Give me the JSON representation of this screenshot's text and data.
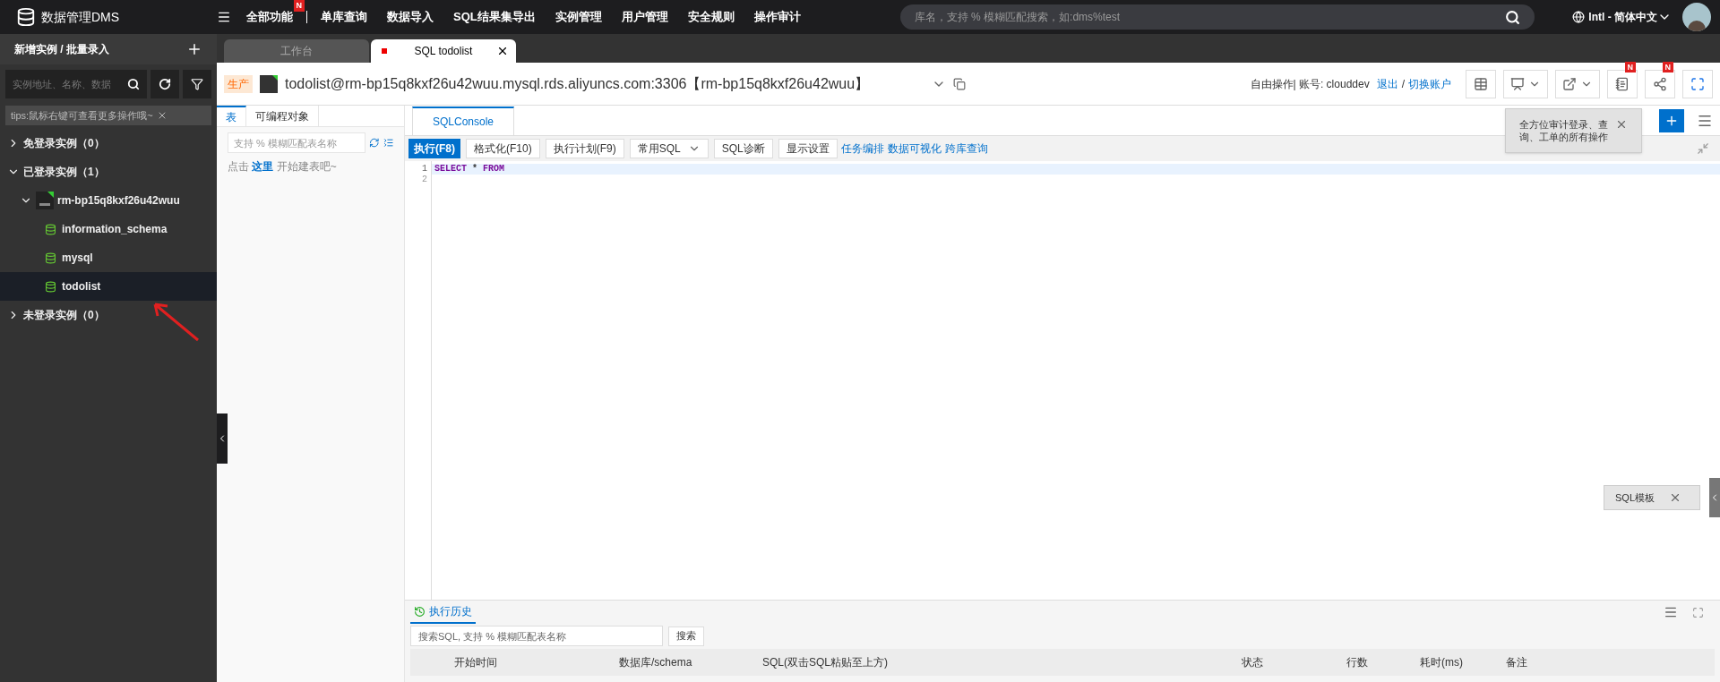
{
  "app": {
    "title": "数据管理DMS"
  },
  "top_menu": [
    {
      "label": "全部功能",
      "badge": "N"
    },
    {
      "label": "单库查询"
    },
    {
      "label": "数据导入"
    },
    {
      "label": "SQL结果集导出"
    },
    {
      "label": "实例管理"
    },
    {
      "label": "用户管理"
    },
    {
      "label": "安全规则"
    },
    {
      "label": "操作审计"
    }
  ],
  "search": {
    "placeholder": "库名，支持 % 模糊匹配搜索，如:dms%test"
  },
  "language": "Intl - 简体中文",
  "sidebar": {
    "title": "新增实例 / 批量录入",
    "search_placeholder": "实例地址、名称、数据",
    "tip": "tips:鼠标右键可查看更多操作哦~",
    "tree": [
      {
        "label": "免登录实例（0）",
        "kind": "group",
        "expanded": false,
        "selected": false
      },
      {
        "label": "已登录实例（1）",
        "kind": "group",
        "expanded": true,
        "selected": false,
        "children": [
          {
            "label": "rm-bp15q8kxf26u42wuu",
            "kind": "instance",
            "expanded": true,
            "selected": false,
            "children": [
              {
                "label": "information_schema",
                "kind": "database",
                "selected": false
              },
              {
                "label": "mysql",
                "kind": "database",
                "selected": false
              },
              {
                "label": "todolist",
                "kind": "database",
                "selected": true
              }
            ]
          }
        ]
      },
      {
        "label": "未登录实例（0）",
        "kind": "group",
        "expanded": false,
        "selected": false
      }
    ]
  },
  "tabs": [
    {
      "label": "工作台",
      "selected": false
    },
    {
      "label": "SQL todolist",
      "selected": true
    }
  ],
  "header": {
    "env": "生产",
    "connection": "todolist@rm-bp15q8kxf26u42wuu.mysql.rds.aliyuncs.com:3306【rm-bp15q8kxf26u42wuu】",
    "account": "自由操作| 账号: clouddev",
    "logout": "退出",
    "separator": "/",
    "switch": "切换账户",
    "tools": [
      {
        "kind": "table",
        "dropdown": false
      },
      {
        "kind": "chart",
        "dropdown": true
      },
      {
        "kind": "export",
        "dropdown": true
      },
      {
        "kind": "audit",
        "dropdown": false,
        "badge": "N"
      },
      {
        "kind": "share",
        "dropdown": false,
        "badge": "N"
      },
      {
        "kind": "fullscreen",
        "dropdown": false
      }
    ]
  },
  "object_panel": {
    "tabs": [
      {
        "label": "表",
        "selected": true
      },
      {
        "label": "可编程对象",
        "selected": false
      }
    ],
    "search_placeholder": "支持 % 模糊匹配表名称",
    "hint": {
      "before": "点击",
      "link": "这里",
      "after": "开始建表吧~"
    }
  },
  "editor": {
    "tabs": [
      {
        "label": "SQLConsole",
        "selected": true
      }
    ],
    "toolbar": [
      {
        "label": "执行(F8)",
        "kind": "primary"
      },
      {
        "label": "格式化(F10)",
        "kind": "button"
      },
      {
        "label": "执行计划(F9)",
        "kind": "button"
      },
      {
        "label": "常用SQL",
        "kind": "dropdown"
      },
      {
        "label": "SQL诊断",
        "kind": "button"
      },
      {
        "label": "显示设置",
        "kind": "button"
      },
      {
        "label": "任务编排",
        "kind": "link"
      },
      {
        "label": "数据可视化",
        "kind": "link"
      },
      {
        "label": "跨库查询",
        "kind": "link"
      }
    ],
    "lines": [
      {
        "number": "1",
        "active": true,
        "tokens": [
          {
            "text": "SELECT",
            "kind": "keyword"
          },
          {
            "text": "*",
            "kind": "plain"
          },
          {
            "text": "FROM",
            "kind": "keyword"
          }
        ]
      },
      {
        "number": "2",
        "active": false
      }
    ]
  },
  "tooltip": "全方位审计登录、查询、工单的所有操作",
  "template_panel": "SQL模板",
  "history": {
    "tab": "执行历史",
    "search_placeholder": "搜索SQL, 支持 % 模糊匹配表名称",
    "search_button": "搜索",
    "columns": [
      "开始时间",
      "数据库/schema",
      "SQL(双击SQL粘贴至上方)",
      "状态",
      "行数",
      "耗时(ms)",
      "备注"
    ]
  }
}
